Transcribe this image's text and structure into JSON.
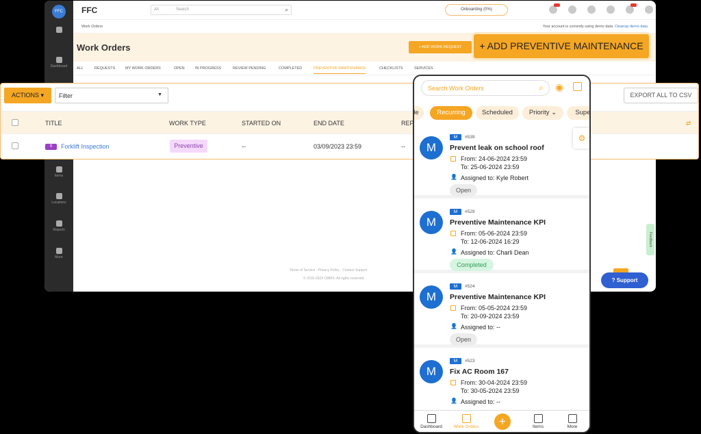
{
  "desktop": {
    "sidebar": {
      "logo": "FFC",
      "items": [
        "Dashboard",
        "Items",
        "Locations",
        "Reports",
        "More"
      ]
    },
    "topbar": {
      "brand": "FFC",
      "search_scope": "All",
      "search_placeholder": "Search",
      "onboarding": "Onboarding (0%)",
      "icons": [
        "bell-icon",
        "clock-icon",
        "calendar-icon",
        "cart-icon",
        "notifications-icon",
        "gear-icon",
        "user-icon"
      ]
    },
    "breadcrumb": "Work Orders",
    "demo_note": "Your account is currently using demo data.",
    "demo_link": "Cleanup demo data",
    "page_title": "Work Orders",
    "add_request_label": "+ ADD WORK REQUEST",
    "tabs": [
      "ALL",
      "REQUESTS",
      "MY WORK ORDERS",
      "OPEN",
      "IN PROGRESS",
      "REVIEW PENDING",
      "COMPLETED",
      "PREVENTIVE MAINTENANCE",
      "CHECKLISTS",
      "SERVICES"
    ],
    "active_tab": "PREVENTIVE MAINTENANCE",
    "footer_links": "Terms of Service · Privacy Policy · Contact Support",
    "footer_copy": "© 2016-2023 CMMS. All rights reserved.",
    "feedback_label": "Feedback",
    "support_label": "Support"
  },
  "table_panel": {
    "actions_label": "ACTIONS ▾",
    "filter_placeholder": "Filter",
    "export_label": "EXPORT ALL TO CSV",
    "columns": [
      "TITLE",
      "WORK TYPE",
      "STARTED ON",
      "END DATE",
      "REPE"
    ],
    "row": {
      "priority_tag": "S",
      "title": "Forklift Inspection",
      "work_type": "Preventive",
      "started_on": "--",
      "end_date": "03/09/2023 23:59",
      "repeat": "--"
    }
  },
  "add_preventive_label": "+ ADD PREVENTIVE MAINTENANCE",
  "mobile": {
    "search_placeholder": "Search Work Orders",
    "chips": [
      "le",
      "Recurring",
      "Scheduled",
      "Priority",
      "Super"
    ],
    "active_chip": "Recurring",
    "cards": [
      {
        "avatar": "M",
        "tag": "M",
        "number": "#539",
        "title": "Prevent leak on school roof",
        "from": "From: 24-06-2024  23:59",
        "to": "To: 25-06-2024  23:59",
        "assigned": "Assigned to: Kyle Robert",
        "status": "Open"
      },
      {
        "avatar": "M",
        "tag": "M",
        "number": "#529",
        "title": "Preventive Maintenance KPI",
        "from": "From: 05-06-2024  23:59",
        "to": "To: 12-06-2024 16:29",
        "assigned": "Assigned to: Charli Dean",
        "status": "Completed"
      },
      {
        "avatar": "M",
        "tag": "M",
        "number": "#524",
        "title": "Preventive Maintenance KPI",
        "from": "From: 05-05-2024  23:59",
        "to": "To: 20-09-2024  23:59",
        "assigned": "Assigned to: --",
        "status": "Open"
      },
      {
        "avatar": "M",
        "tag": "M",
        "number": "#523",
        "title": "Fix AC Room 167",
        "from": "From: 30-04-2024  23:59",
        "to": "To: 30-05-2024  23:59",
        "assigned": "Assigned to: --",
        "status": ""
      }
    ],
    "nav": [
      "Dashboard",
      "Work Orders",
      "",
      "Items",
      "More"
    ],
    "fab": "+"
  },
  "colors": {
    "accent": "#f5a623",
    "avatar": "#1d6fd1",
    "support": "#2f5fd0",
    "sidebar": "#2b2b2b"
  }
}
